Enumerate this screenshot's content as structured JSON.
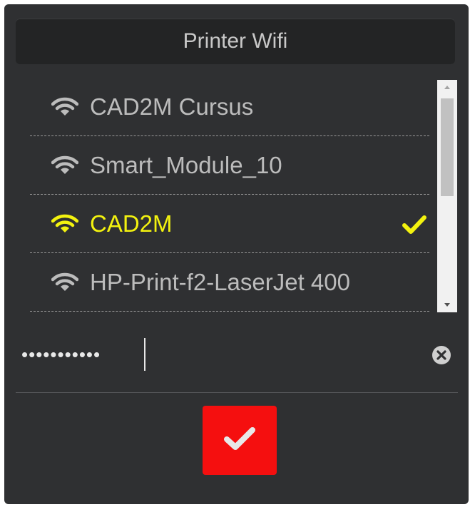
{
  "header": {
    "title": "Printer Wifi"
  },
  "networks": [
    {
      "ssid": "CAD2M Cursus",
      "selected": false
    },
    {
      "ssid": "Smart_Module_10",
      "selected": false
    },
    {
      "ssid": "CAD2M",
      "selected": true
    },
    {
      "ssid": "HP-Print-f2-LaserJet 400",
      "selected": false
    }
  ],
  "password": {
    "value": "•••••••••••"
  },
  "icons": {
    "wifi": "wifi-icon",
    "check": "check-icon",
    "clear": "clear-circle-x-icon",
    "confirm": "checkmark-icon"
  },
  "colors": {
    "panel": "#2f3032",
    "selected": "#f3f20f",
    "normal_text": "#bcbcbc",
    "confirm_button": "#f50f0f"
  }
}
